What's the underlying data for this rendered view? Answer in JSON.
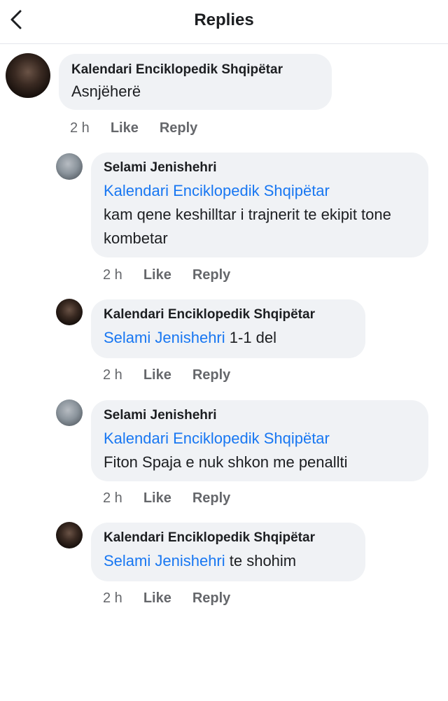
{
  "header": {
    "title": "Replies",
    "back_icon": "chevron-left-icon"
  },
  "comments": [
    {
      "author": "Kalendari Enciklopedik Shqipëtar",
      "mention": "",
      "text": "Asnjëherë",
      "time": "2 h",
      "like": "Like",
      "reply": "Reply"
    },
    {
      "author": "Selami Jenishehri",
      "mention": "Kalendari Enciklopedik Shqipëtar",
      "text": "kam qene keshilltar i trajnerit te ekipit  tone kombetar",
      "time": "2 h",
      "like": "Like",
      "reply": "Reply"
    },
    {
      "author": "Kalendari Enciklopedik Shqipëtar",
      "mention": "Selami Jenishehri",
      "text": " 1-1 del",
      "time": "2 h",
      "like": "Like",
      "reply": "Reply"
    },
    {
      "author": "Selami Jenishehri",
      "mention": "Kalendari Enciklopedik Shqipëtar",
      "text": "Fiton Spaja e nuk shkon me penallti",
      "time": "2 h",
      "like": "Like",
      "reply": "Reply"
    },
    {
      "author": "Kalendari Enciklopedik Shqipëtar",
      "mention": "Selami Jenishehri",
      "text": " te shohim",
      "time": "2 h",
      "like": "Like",
      "reply": "Reply"
    }
  ],
  "colors": {
    "mention": "#1877f2",
    "bubble": "#f0f2f5",
    "meta": "#65676b"
  }
}
